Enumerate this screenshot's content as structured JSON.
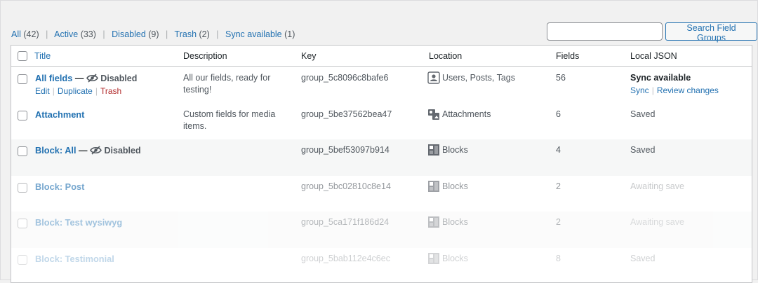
{
  "filters": [
    {
      "label": "All",
      "count": "(42)"
    },
    {
      "label": "Active",
      "count": "(33)"
    },
    {
      "label": "Disabled",
      "count": "(9)"
    },
    {
      "label": "Trash",
      "count": "(2)"
    },
    {
      "label": "Sync available",
      "count": "(1)"
    }
  ],
  "search": {
    "value": "",
    "button": "Search Field Groups"
  },
  "columns": {
    "title": "Title",
    "description": "Description",
    "key": "Key",
    "location": "Location",
    "fields": "Fields",
    "local_json": "Local JSON"
  },
  "rows": [
    {
      "title": "All fields",
      "dash": "—",
      "status": "Disabled",
      "actions": {
        "edit": "Edit",
        "duplicate": "Duplicate",
        "trash": "Trash"
      },
      "description": "All our fields, ready for testing!",
      "key": "group_5c8096c8bafe6",
      "location_icon": "user-icon",
      "location": "Users, Posts, Tags",
      "fields": "56",
      "local_json": "Sync available",
      "json_actions": {
        "sync": "Sync",
        "review": "Review changes"
      }
    },
    {
      "title": "Attachment",
      "description": "Custom fields for media items.",
      "key": "group_5be37562bea47",
      "location_icon": "media-icon",
      "location": "Attachments",
      "fields": "6",
      "local_json": "Saved"
    },
    {
      "title": "Block: All",
      "dash": "—",
      "status": "Disabled",
      "description": "",
      "key": "group_5bef53097b914",
      "location_icon": "blocks-icon",
      "location": "Blocks",
      "fields": "4",
      "local_json": "Saved"
    },
    {
      "title": "Block: Post",
      "description": "",
      "key": "group_5bc02810c8e14",
      "location_icon": "blocks-icon",
      "location": "Blocks",
      "fields": "2",
      "local_json": "Awaiting save"
    },
    {
      "title": "Block: Test wysiwyg",
      "description": "",
      "key": "group_5ca171f186d24",
      "location_icon": "blocks-icon",
      "location": "Blocks",
      "fields": "2",
      "local_json": "Awaiting save"
    },
    {
      "title": "Block: Testimonial",
      "description": "",
      "key": "group_5bab112e4c6ec",
      "location_icon": "blocks-icon",
      "location": "Blocks",
      "fields": "8",
      "local_json": "Saved"
    }
  ],
  "colors": {
    "link": "#2271b1",
    "trash": "#b32d2e",
    "text": "#50575e",
    "alt_row": "#f6f7f7"
  }
}
